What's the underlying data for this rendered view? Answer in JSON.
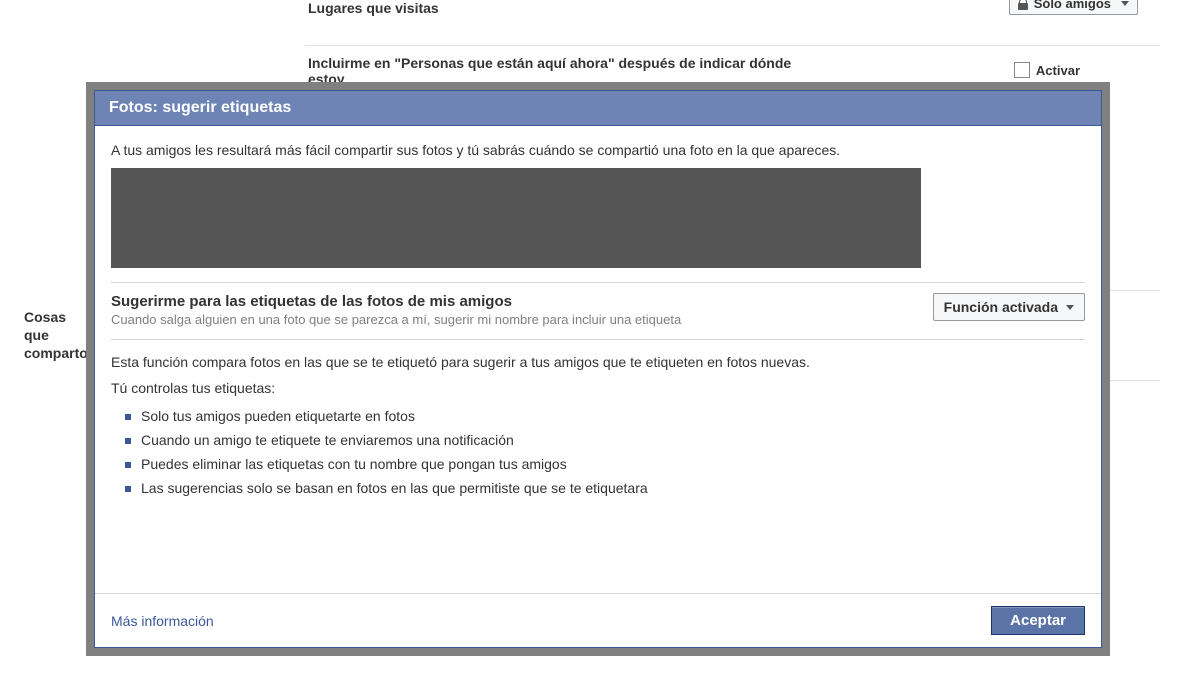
{
  "background": {
    "row1_label": "Lugares que visitas",
    "row1_selector": "Sólo amigos",
    "row2_label": "Incluirme en \"Personas que están aquí ahora\" después de indicar dónde estoy",
    "row2_checkbox": "Activar",
    "side_label": "Cosas que comparto"
  },
  "dialog": {
    "title": "Fotos: sugerir etiquetas",
    "intro": "A tus amigos les resultará más fácil compartir sus fotos y tú sabrás cuándo se compartió una foto en la que apareces.",
    "setting_title": "Sugerirme para las etiquetas de las fotos de mis amigos",
    "setting_sub": "Cuando salga alguien en una foto que se parezca a mí, sugerir mi nombre para incluir una etiqueta",
    "dropdown_value": "Función activada",
    "explain": "Esta función compara fotos en las que se te etiquetó para sugerir a tus amigos que te etiqueten en fotos nuevas.",
    "control_heading": "Tú controlas tus etiquetas:",
    "bullets": [
      "Solo tus amigos pueden etiquetarte en fotos",
      "Cuando un amigo te etiquete te enviaremos una notificación",
      "Puedes eliminar las etiquetas con tu nombre que pongan tus amigos",
      "Las sugerencias solo se basan en fotos en las que permitiste que se te etiquetara"
    ],
    "more_info": "Más información",
    "accept": "Aceptar"
  }
}
